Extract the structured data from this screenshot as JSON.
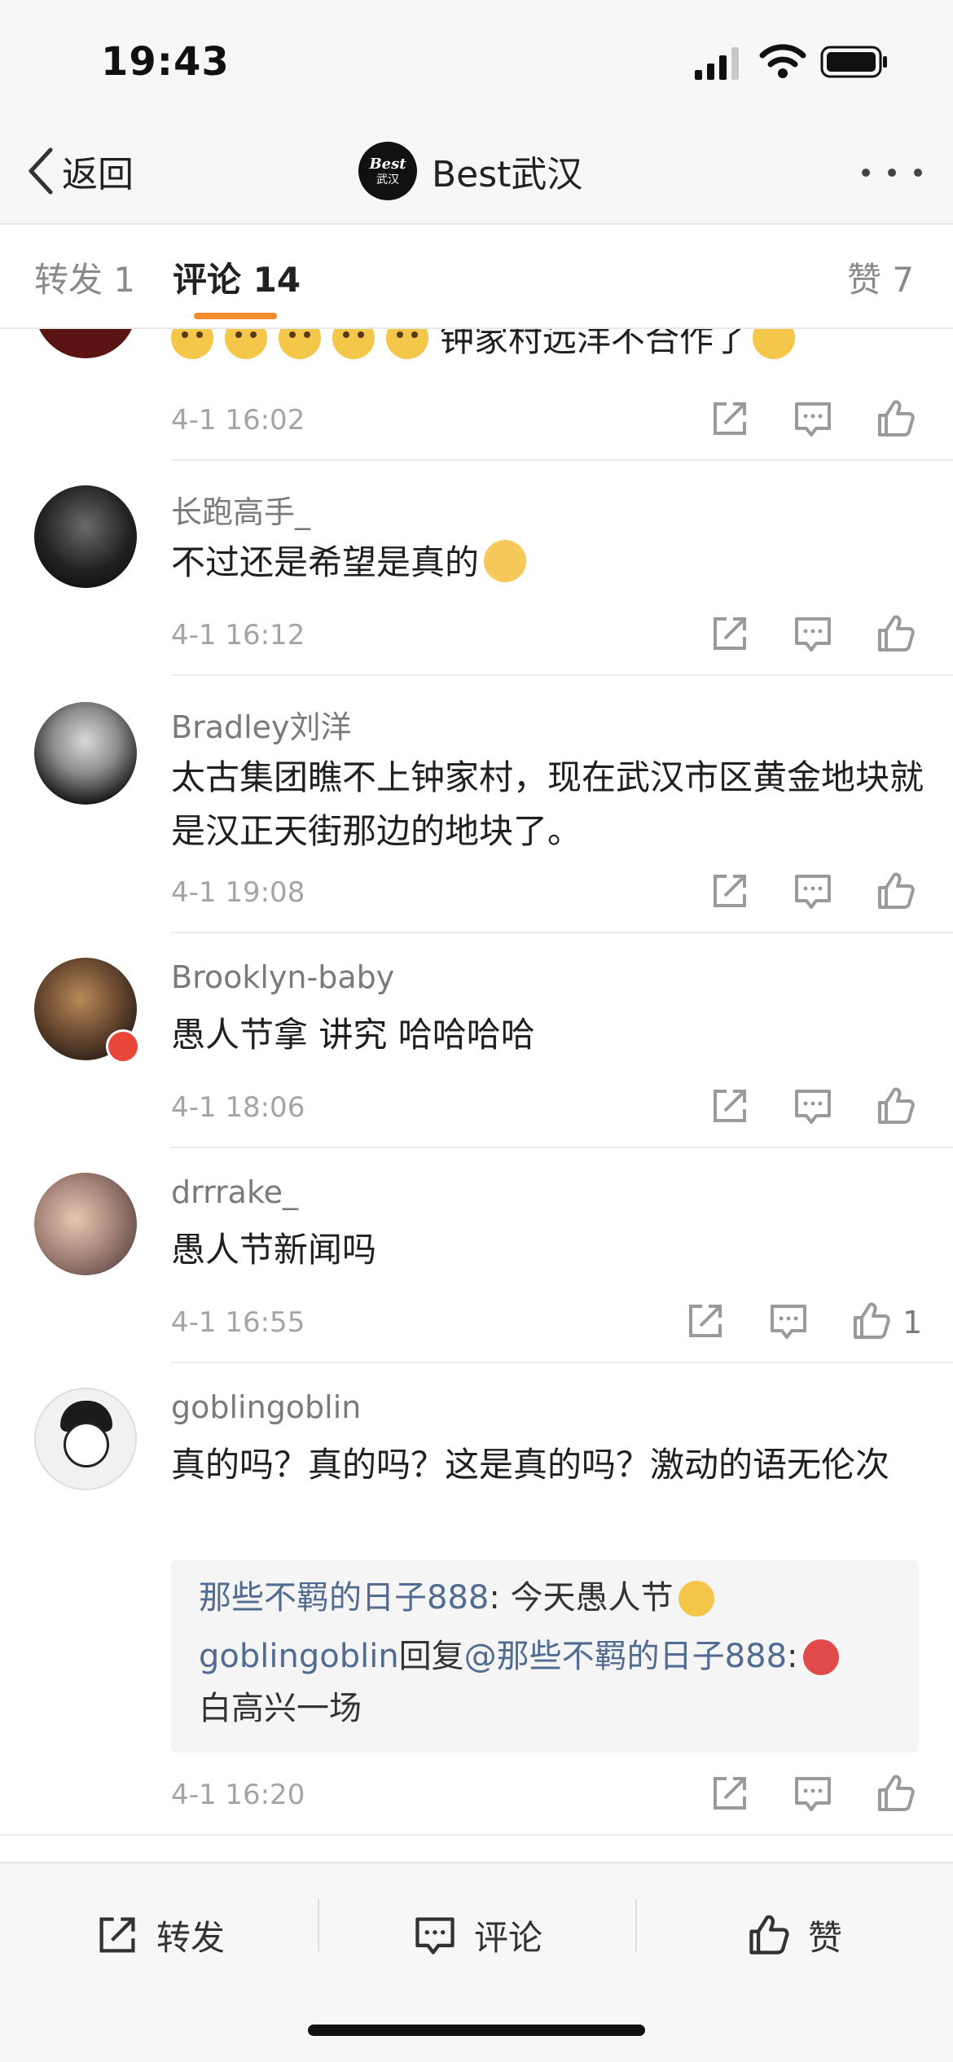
{
  "status_bar": {
    "time": "19:43"
  },
  "nav": {
    "back_label": "返回",
    "logo_line1": "Best",
    "logo_line2": "武汉",
    "title": "Best武汉"
  },
  "tabs": {
    "repost": "转发 1",
    "comments": "评论 14",
    "likes": "赞 7"
  },
  "comments": [
    {
      "name": "",
      "text": "钟家村远洋不合作了",
      "time": "4-1 16:02",
      "likes": ""
    },
    {
      "name": "长跑高手_",
      "text": "不过还是希望是真的",
      "time": "4-1 16:12",
      "likes": ""
    },
    {
      "name": "Bradley刘洋",
      "text": "太古集团瞧不上钟家村，现在武汉市区黄金地块就是汉正天街那边的地块了。",
      "time": "4-1 19:08",
      "likes": ""
    },
    {
      "name": "Brooklyn-baby",
      "text": "愚人节拿 讲究 哈哈哈哈",
      "time": "4-1 18:06",
      "likes": ""
    },
    {
      "name": "drrrake_",
      "text": "愚人节新闻吗",
      "time": "4-1 16:55",
      "likes": "1"
    },
    {
      "name": "goblingoblin",
      "text": "真的吗？真的吗？这是真的吗？激动的语无伦次",
      "time": "4-1 16:20",
      "likes": "",
      "replies": {
        "r1_user": "那些不羁的日子888",
        "r1_text": ": 今天愚人节",
        "r2_user": "goblingoblin",
        "r2_mid": "回复",
        "r2_mention": "@那些不羁的日子888",
        "r2_colon": ":",
        "r2_text": "白高兴一场"
      }
    }
  ],
  "bottom_bar": {
    "repost_label": "转发",
    "comment_label": "评论",
    "like_label": "赞"
  },
  "colors": {
    "accent_underline": "#f38b2c",
    "reply_name": "#516b91",
    "meta_gray": "#a4a4a4"
  }
}
